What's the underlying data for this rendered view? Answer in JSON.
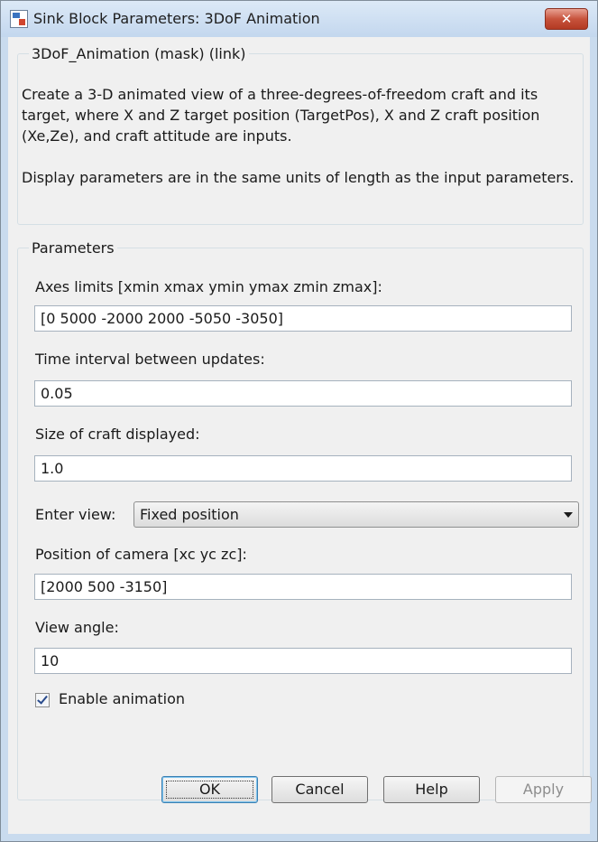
{
  "window": {
    "title": "Sink Block Parameters: 3DoF Animation",
    "close_label": "✕"
  },
  "description": {
    "group_label": "3DoF_Animation (mask) (link)",
    "paragraph1": "Create a 3-D animated view of a three-degrees-of-freedom craft and its target, where X and Z target position (TargetPos), X and Z craft position (Xe,Ze), and craft attitude are inputs.",
    "paragraph2": "Display parameters are in the same units of length as the input parameters."
  },
  "parameters": {
    "group_label": "Parameters",
    "axes_limits": {
      "label": "Axes limits [xmin xmax ymin ymax zmin zmax]:",
      "value": "[0 5000 -2000 2000 -5050 -3050]"
    },
    "time_interval": {
      "label": "Time interval between updates:",
      "value": "0.05"
    },
    "craft_size": {
      "label": "Size of craft displayed:",
      "value": "1.0"
    },
    "enter_view": {
      "label": "Enter view:",
      "selected": "Fixed position"
    },
    "camera_position": {
      "label": "Position of camera [xc yc zc]:",
      "value": "[2000 500 -3150]"
    },
    "view_angle": {
      "label": "View angle:",
      "value": "10"
    },
    "enable_animation": {
      "label": "Enable animation",
      "checked": true
    }
  },
  "buttons": {
    "ok": "OK",
    "cancel": "Cancel",
    "help": "Help",
    "apply": "Apply"
  }
}
